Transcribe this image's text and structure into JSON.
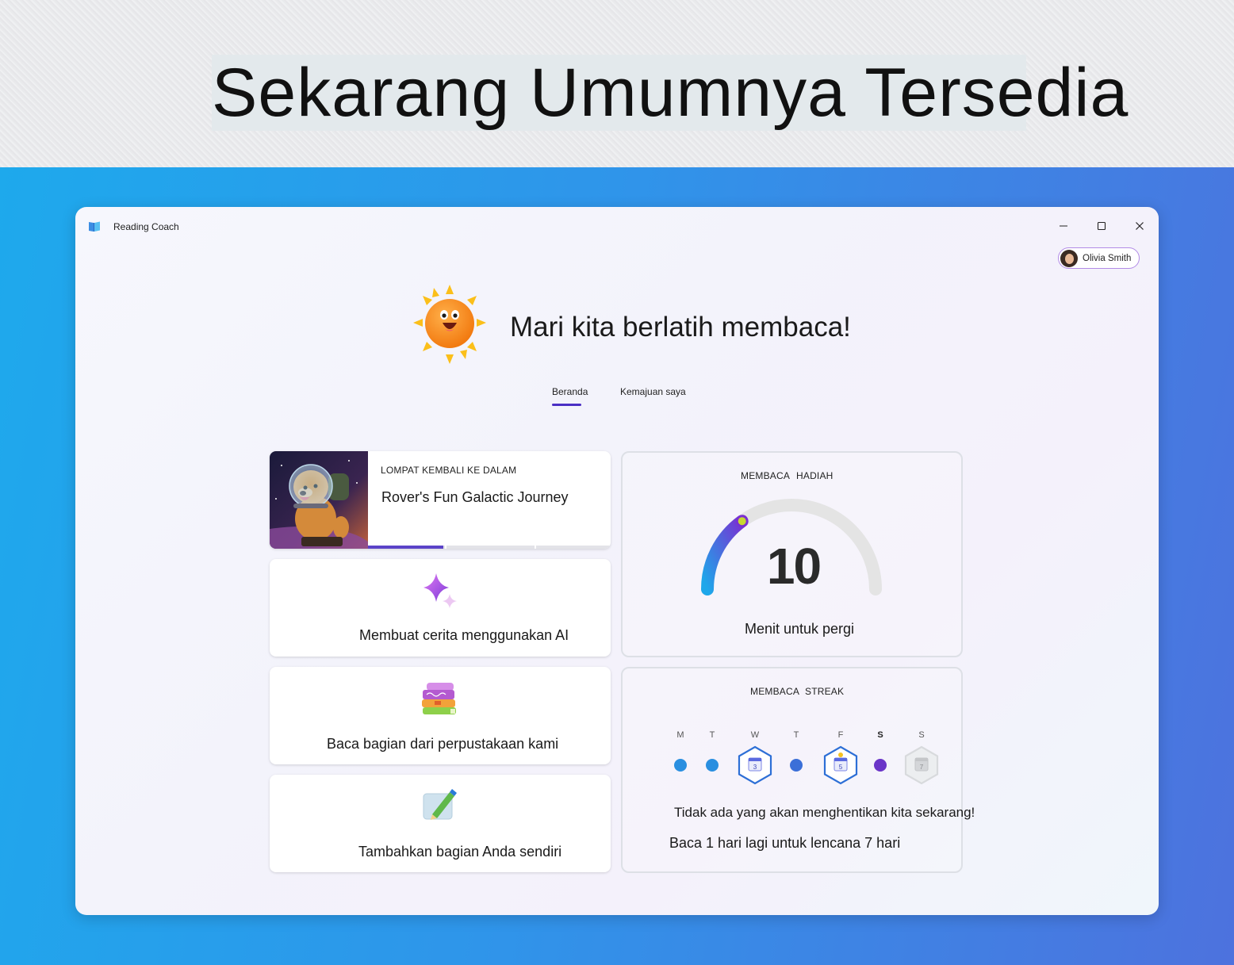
{
  "banner": {
    "title": "Sekarang Umumnya Tersedia"
  },
  "window": {
    "title": "Reading Coach",
    "controls": {
      "minimize": "minimize-icon",
      "maximize": "maximize-icon",
      "close": "close-icon"
    }
  },
  "profile": {
    "name": "Olivia Smith"
  },
  "hero": {
    "headline": "Mari kita berlatih membaca!"
  },
  "tabs": [
    {
      "label": "Beranda",
      "active": true
    },
    {
      "label": "Kemajuan saya",
      "active": false
    }
  ],
  "cards": {
    "resume": {
      "eyebrow": "LOMPAT KEMBALI KE DALAM",
      "title": "Rover's Fun Galactic Journey",
      "progress_segments": [
        1,
        0,
        0
      ]
    },
    "ai_story": {
      "label": "Membuat cerita menggunakan AI",
      "icon": "sparkle-icon"
    },
    "library": {
      "label": "Baca bagian dari perpustakaan kami",
      "icon": "books-icon"
    },
    "own_passage": {
      "label": "Tambahkan bagian Anda sendiri",
      "icon": "pen-paper-icon"
    }
  },
  "reward": {
    "heading_left": "MEMBACA",
    "heading_right": "HADIAH",
    "value": "10",
    "caption": "Menit untuk pergi",
    "progress_fraction": 0.3
  },
  "streak": {
    "heading_left": "MEMBACA",
    "heading_right": "STREAK",
    "days": [
      {
        "letter": "M",
        "state": "dot",
        "bold": false
      },
      {
        "letter": "T",
        "state": "dot",
        "bold": false
      },
      {
        "letter": "W",
        "state": "badge",
        "badge_number": "3",
        "bold": false
      },
      {
        "letter": "T",
        "state": "dot",
        "bold": false
      },
      {
        "letter": "F",
        "state": "badge",
        "badge_number": "5",
        "bold": false
      },
      {
        "letter": "S",
        "state": "dot-today",
        "bold": true
      },
      {
        "letter": "S",
        "state": "badge-locked",
        "badge_number": "7",
        "bold": false
      }
    ],
    "message": "Tidak ada yang akan menghentikan kita sekarang!",
    "hint": "Baca 1 hari lagi untuk lencana 7 hari"
  },
  "colors": {
    "accent": "#4a2fc4",
    "gauge_start": "#1ea7ea",
    "gauge_end": "#7a2fd2",
    "gauge_track": "#e4e4e4"
  }
}
